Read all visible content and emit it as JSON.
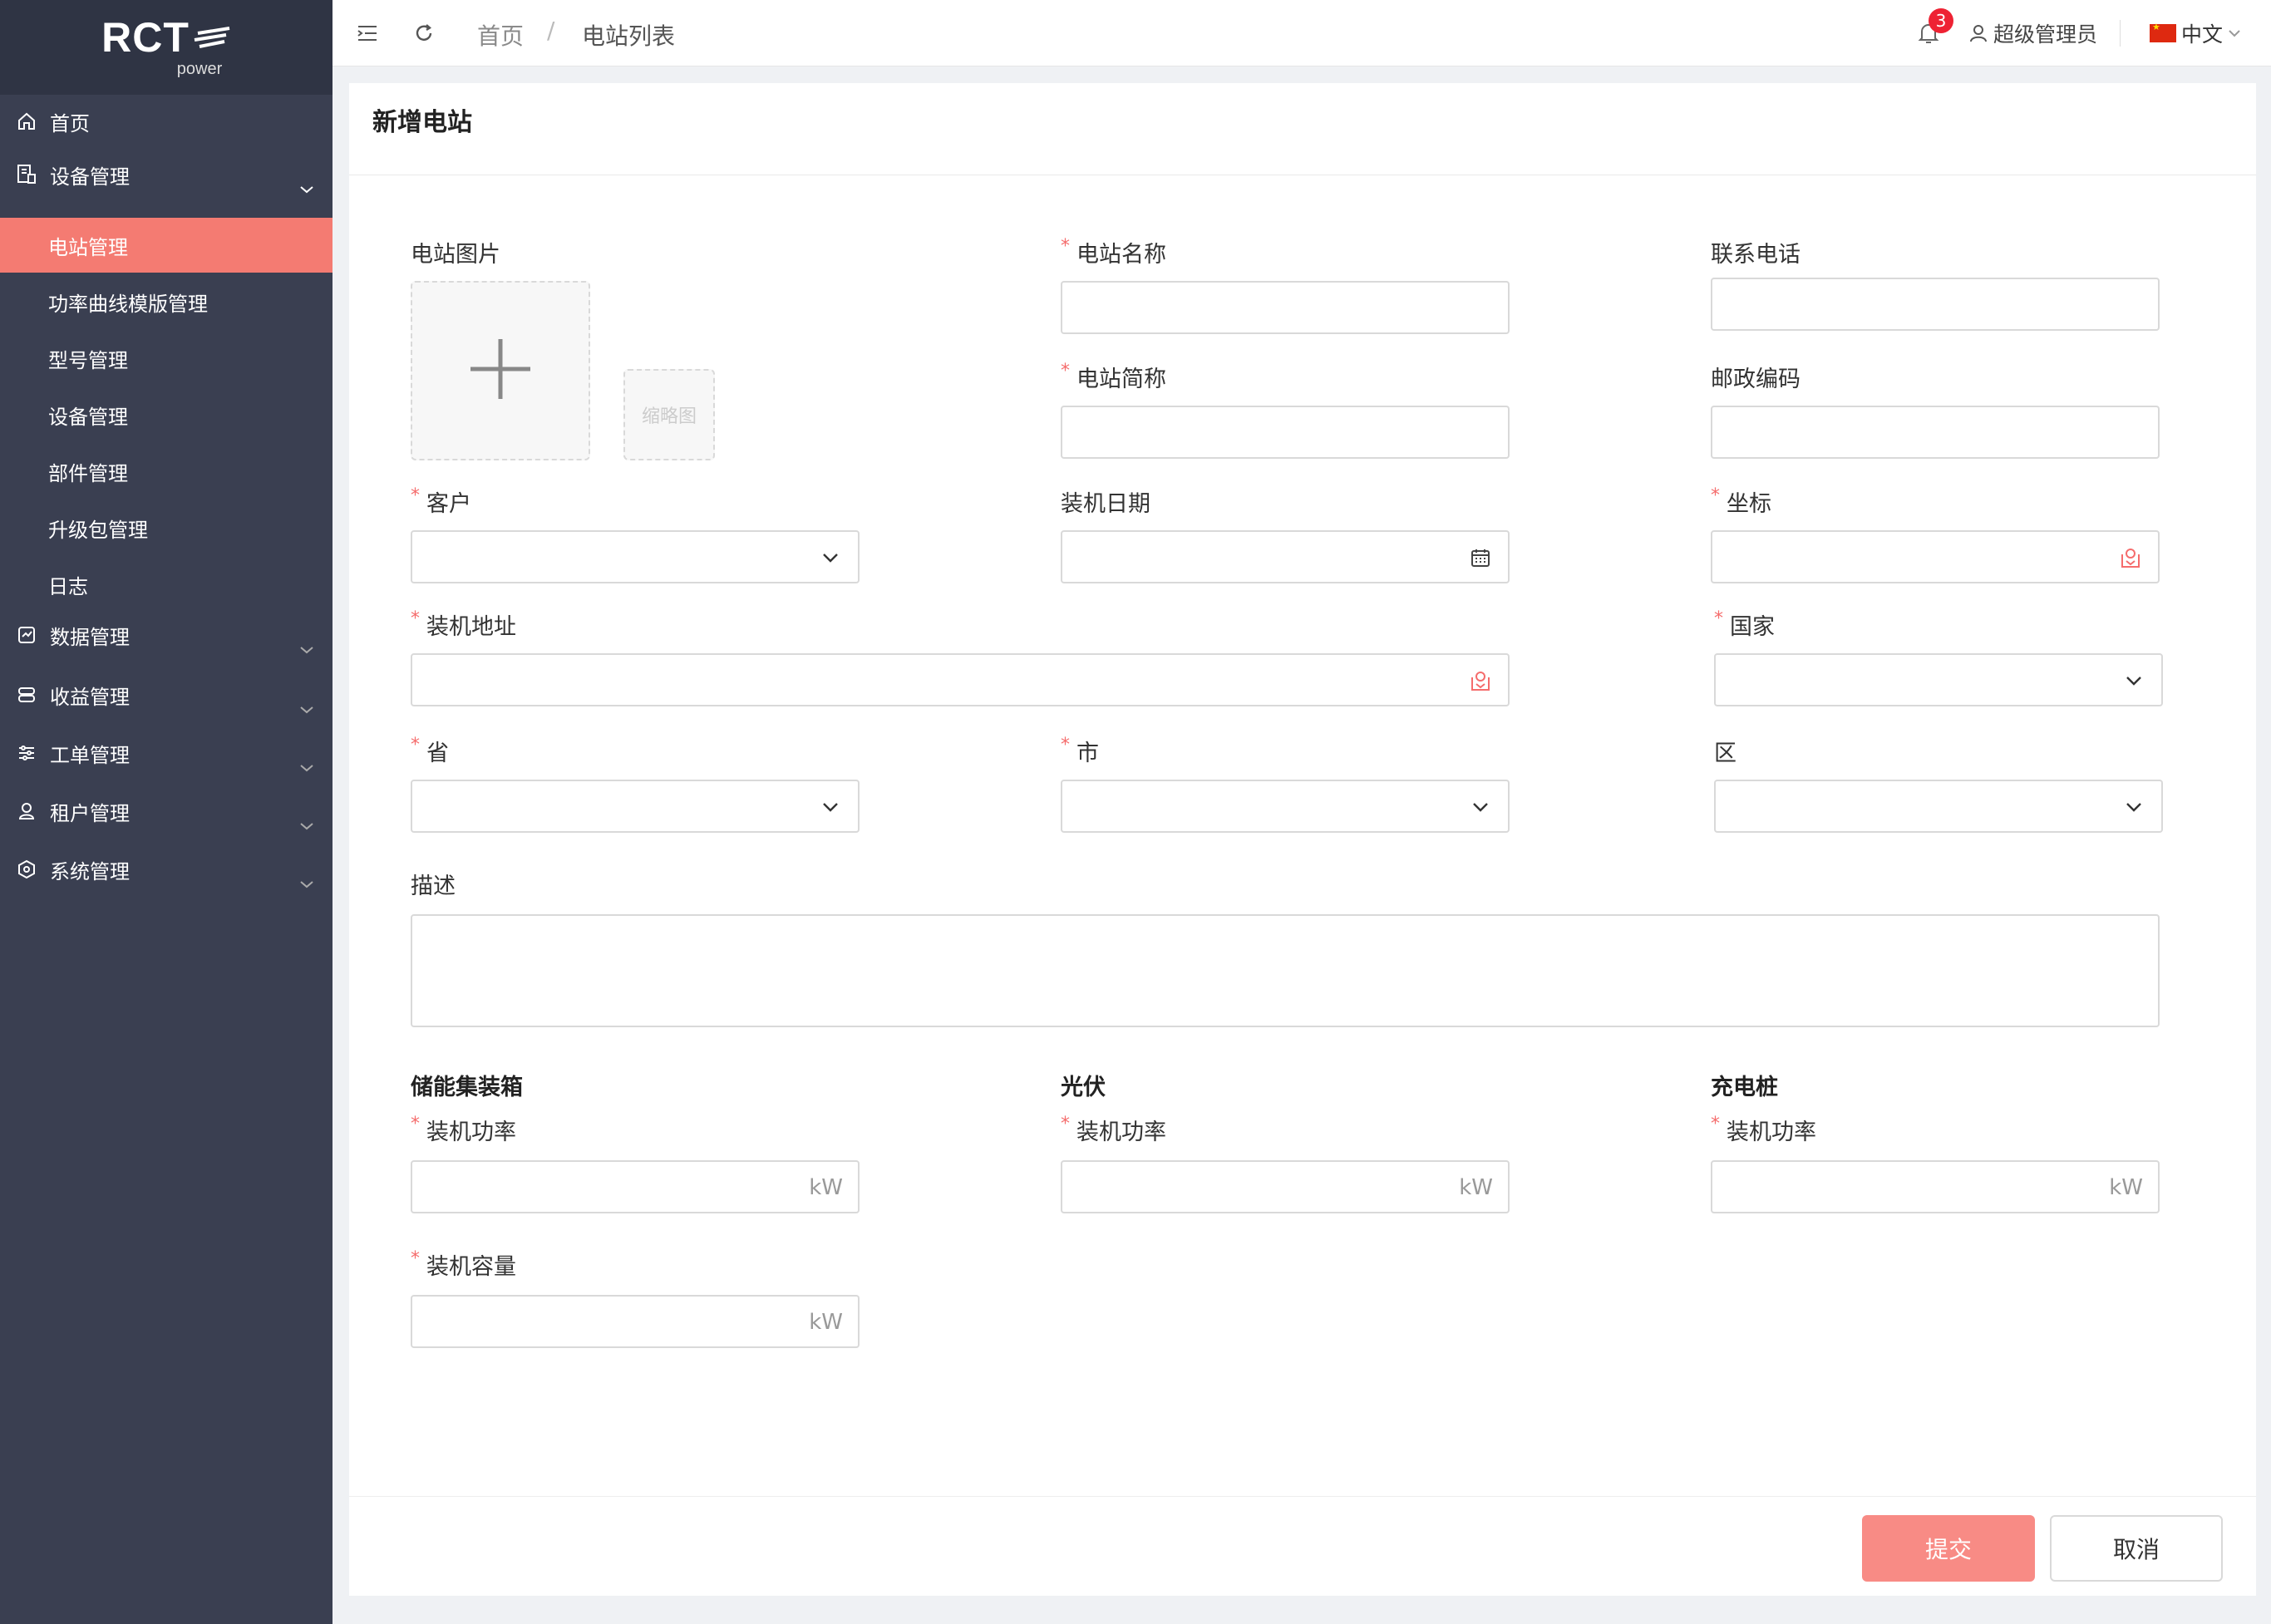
{
  "brand": {
    "logo_text": "RCT",
    "logo_sub": "power"
  },
  "sidebar": {
    "items": [
      {
        "label": "首页",
        "icon": "home-icon"
      },
      {
        "label": "设备管理",
        "icon": "device-icon",
        "expanded": true
      },
      {
        "label": "数据管理",
        "icon": "data-icon"
      },
      {
        "label": "收益管理",
        "icon": "revenue-icon"
      },
      {
        "label": "工单管理",
        "icon": "workorder-icon"
      },
      {
        "label": "租户管理",
        "icon": "tenant-icon"
      },
      {
        "label": "系统管理",
        "icon": "system-icon"
      }
    ],
    "submenu": [
      {
        "label": "电站管理",
        "active": true
      },
      {
        "label": "功率曲线模版管理"
      },
      {
        "label": "型号管理"
      },
      {
        "label": "设备管理"
      },
      {
        "label": "部件管理"
      },
      {
        "label": "升级包管理"
      },
      {
        "label": "日志"
      }
    ],
    "active_color": "#f47b72",
    "bg_color": "#3a3f51"
  },
  "header": {
    "breadcrumb": [
      "首页",
      "电站列表"
    ],
    "breadcrumb_sep": "/",
    "notification_count": "3",
    "user_name": "超级管理员",
    "language": "中文"
  },
  "form": {
    "title": "新增电站",
    "upload_label": "电站图片",
    "thumbnail_text": "缩略图",
    "station_name": "电站名称",
    "contact_phone": "联系电话",
    "station_short": "电站简称",
    "postal_code": "邮政编码",
    "customer": "客户",
    "install_date": "装机日期",
    "coordinates": "坐标",
    "install_address": "装机地址",
    "country": "国家",
    "province": "省",
    "city": "市",
    "district": "区",
    "description": "描述",
    "section_storage": "储能集装箱",
    "section_pv": "光伏",
    "section_charger": "充电桩",
    "install_power": "装机功率",
    "install_capacity": "装机容量",
    "unit": "kW",
    "required_mark": "*"
  },
  "actions": {
    "submit": "提交",
    "cancel": "取消",
    "submit_color": "#f88b85"
  }
}
